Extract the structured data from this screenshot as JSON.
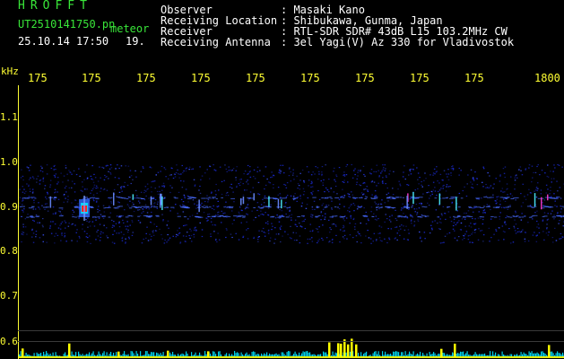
{
  "header": {
    "title": "HROFFT",
    "filename": "UT2510141750.pn",
    "tag": "meteor",
    "datetime": "25.10.14 17:50",
    "count": "19."
  },
  "info": [
    {
      "label": "Observer",
      "value": ": Masaki Kano"
    },
    {
      "label": "Receiving Location",
      "value": ": Shibukawa, Gunma, Japan"
    },
    {
      "label": "Receiver",
      "value": ": RTL-SDR SDR# 43dB L15 103.2MHz CW"
    },
    {
      "label": "Receiving Antenna",
      "value": ": 3el Yagi(V) Az 330 for Vladivostok"
    }
  ],
  "axis": {
    "y_unit": "kHz",
    "x_ticks": [
      "175",
      "175",
      "175",
      "175",
      "175",
      "175",
      "175",
      "175",
      "175",
      "1800"
    ],
    "y_ticks": [
      "1.1",
      "1.0",
      "0.9",
      "0.8",
      "0.7",
      "0.6"
    ]
  },
  "colors": {
    "label_green": "#39e639",
    "axis_yellow": "#ffff33",
    "noise_blue": "#1a2ad0",
    "echo_red": "#ff2020",
    "spectrum_yellow": "#ffff00",
    "spectrum_cyan": "#00e5ff"
  },
  "chart_data": {
    "type": "heatmap",
    "x_range_minutes": [
      1750,
      1800
    ],
    "y_range_khz": [
      0.58,
      1.17
    ],
    "noise_band_khz": [
      0.83,
      1.0
    ],
    "echo_lines_khz": [
      0.91,
      0.93,
      0.89
    ],
    "meteor_echo_minute": 1756.0,
    "meteor_echo_khz": 0.905
  }
}
